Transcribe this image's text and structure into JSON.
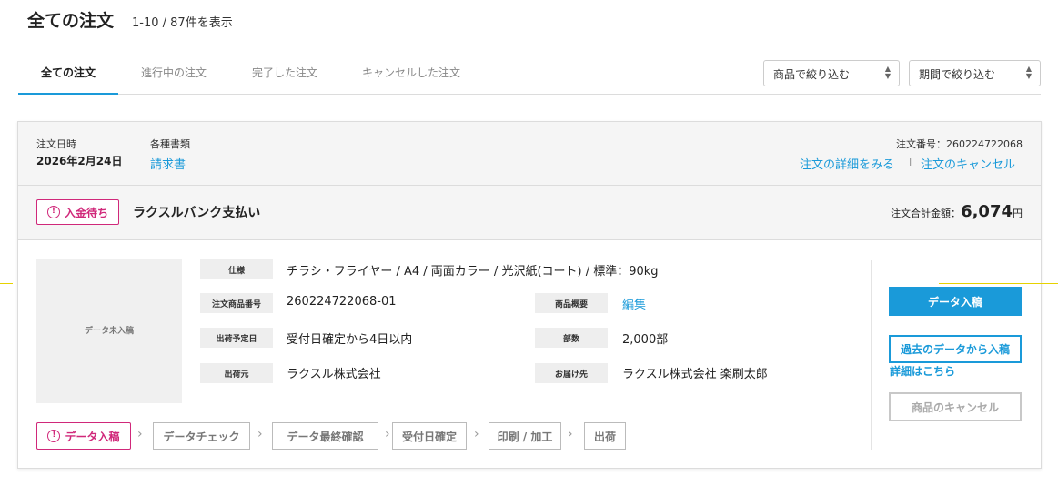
{
  "header": {
    "title": "全ての注文",
    "count": "1-10 / 87件を表示"
  },
  "tabs": [
    {
      "label": "全ての注文",
      "active": true
    },
    {
      "label": "進行中の注文",
      "active": false
    },
    {
      "label": "完了した注文",
      "active": false
    },
    {
      "label": "キャンセルした注文",
      "active": false
    }
  ],
  "filters": {
    "product": "商品で絞り込む",
    "period": "期間で絞り込む"
  },
  "order": {
    "date_label": "注文日時",
    "date_value": "2026年2月24日",
    "docs_label": "各種書類",
    "docs_link": "請求書",
    "number_label": "注文番号：260224722068",
    "detail_link": "注文の詳細をみる",
    "divider": "I",
    "cancel_link": "注文のキャンセル",
    "status_badge": "入金待ち",
    "payment_method": "ラクスルバンク支払い",
    "total_label": "注文合計金額：",
    "total_value": "6,074",
    "total_unit": "円"
  },
  "item": {
    "thumb_text": "データ未入稿",
    "spec_label": "仕様",
    "spec_value": "チラシ・フライヤー / A4 / 両面カラー / 光沢紙(コート) / 標準：90kg",
    "item_no_label": "注文商品番号",
    "item_no_value": "260224722068-01",
    "summary_label": "商品概要",
    "summary_link": "編集",
    "ship_date_label": "出荷予定日",
    "ship_date_value": "受付日確定から4日以内",
    "qty_label": "部数",
    "qty_value": "2,000部",
    "from_label": "出荷元",
    "from_value": "ラクスル株式会社",
    "to_label": "お届け先",
    "to_value": "ラクスル株式会社 楽刷太郎"
  },
  "actions": {
    "upload": "データ入稿",
    "reuse": "過去のデータから入稿",
    "details": "詳細はこちら",
    "cancel_item": "商品のキャンセル"
  },
  "steps": [
    "データ入稿",
    "データチェック",
    "データ最終確認",
    "受付日確定",
    "印刷 / 加工",
    "出荷"
  ],
  "colors": {
    "accent": "#1a9ad9",
    "warning": "#d0287a"
  }
}
